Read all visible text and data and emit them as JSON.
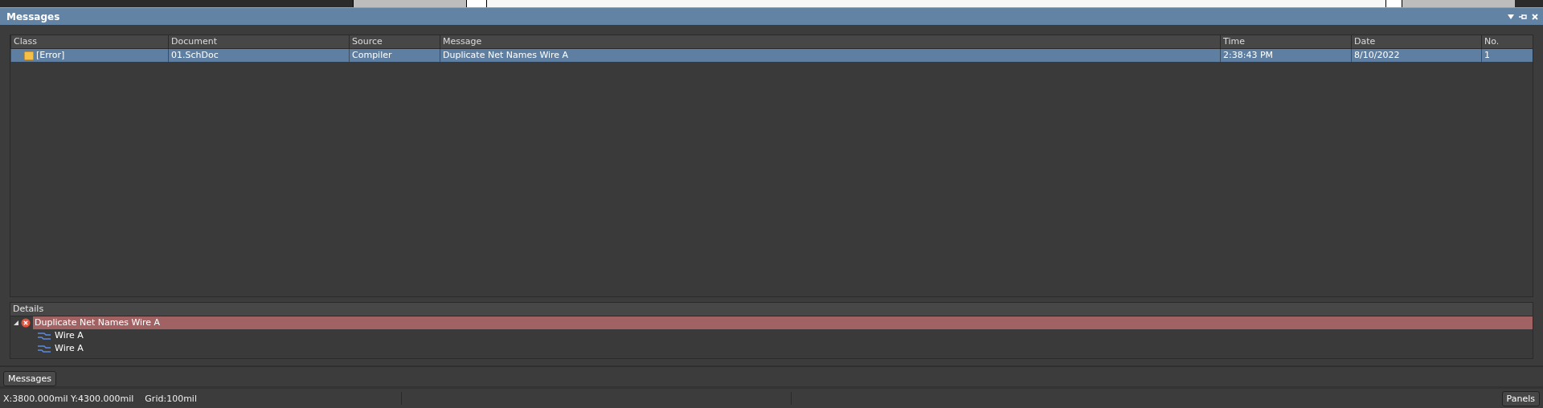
{
  "panel": {
    "title": "Messages"
  },
  "table": {
    "columns": [
      "Class",
      "Document",
      "Source",
      "Message",
      "Time",
      "Date",
      "No."
    ],
    "rows": [
      {
        "selected": true,
        "cells": [
          "[Error]",
          "01.SchDoc",
          "Compiler",
          "Duplicate Net Names Wire A",
          "2:38:43 PM",
          "8/10/2022",
          "1"
        ]
      }
    ]
  },
  "details": {
    "title": "Details",
    "items": [
      {
        "kind": "error",
        "label": "Duplicate Net Names Wire A",
        "expanded": true,
        "selected": true,
        "children": [
          {
            "kind": "net",
            "label": "Wire A",
            "selected": false
          },
          {
            "kind": "net",
            "label": "Wire A",
            "selected": false
          }
        ]
      }
    ]
  },
  "tabs": [
    {
      "label": "Messages",
      "selected": true
    }
  ],
  "status_bar": {
    "texts": [
      "X:3800.000mil Y:4300.000mil",
      "Grid:100mil"
    ],
    "button": "Panels"
  }
}
